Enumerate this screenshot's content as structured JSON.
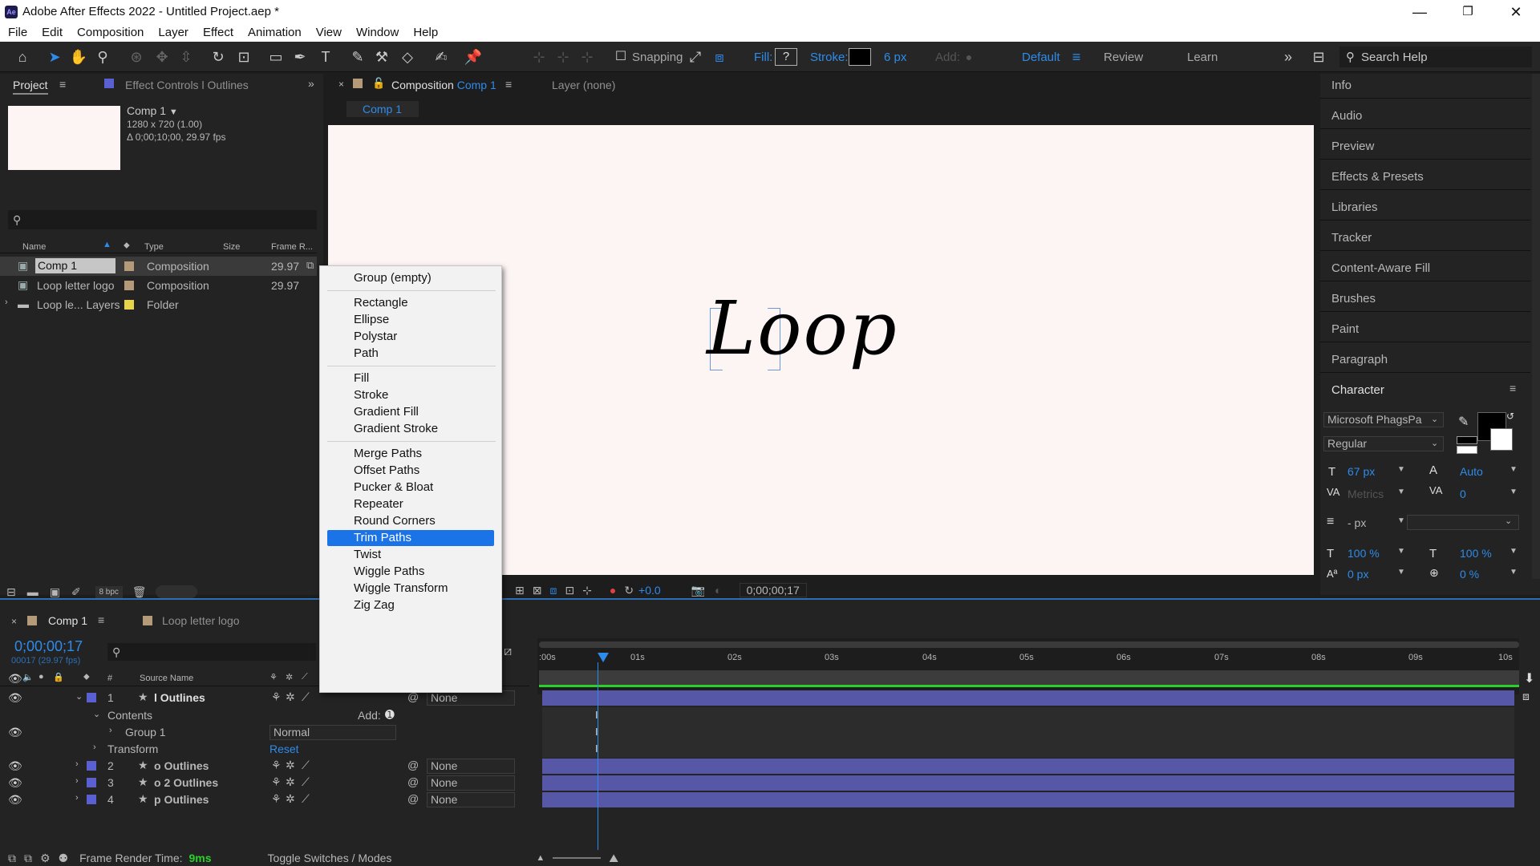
{
  "window": {
    "title": "Adobe After Effects 2022 - Untitled Project.aep *",
    "app_badge": "Ae",
    "controls": [
      "—",
      "❐",
      "✕"
    ]
  },
  "menu": [
    "File",
    "Edit",
    "Composition",
    "Layer",
    "Effect",
    "Animation",
    "View",
    "Window",
    "Help"
  ],
  "toolbar": {
    "snapping_label": "Snapping",
    "fill_label": "Fill:",
    "fill_value": "?",
    "stroke_label": "Stroke:",
    "stroke_width": "6 px",
    "add_label": "Add:",
    "workspaces": [
      "Default",
      "Review",
      "Learn"
    ],
    "active_workspace": "Default",
    "search_placeholder": "Search Help"
  },
  "project_panel": {
    "tab_project": "Project",
    "tab_effect_controls": "Effect Controls l Outlines",
    "comp_name": "Comp 1",
    "comp_res": "1280 x 720 (1.00)",
    "comp_duration": "Δ 0;00;10;00, 29.97 fps",
    "columns": {
      "name": "Name",
      "type": "Type",
      "size": "Size",
      "frame_rate": "Frame R..."
    },
    "items": [
      {
        "name": "Comp 1",
        "type": "Composition",
        "frame_rate": "29.97",
        "label_color": "#b59a7a"
      },
      {
        "name": "Loop letter logo",
        "type": "Composition",
        "frame_rate": "29.97",
        "label_color": "#b59a7a"
      },
      {
        "name": "Loop le... Layers",
        "type": "Folder",
        "frame_rate": "",
        "label_color": "#e8d44a"
      }
    ],
    "bpc": "8 bpc"
  },
  "composition": {
    "tab_label": "Composition",
    "tab_comp": "Comp 1",
    "layer_tab": "Layer  (none)",
    "breadcrumb": "Comp 1",
    "canvas_text": "Loop",
    "canvas_bg": "#fdf4f4",
    "exposure": "+0.0",
    "timecode": "0;00;00;17"
  },
  "context_menu": {
    "groups": [
      [
        "Group (empty)"
      ],
      [
        "Rectangle",
        "Ellipse",
        "Polystar",
        "Path"
      ],
      [
        "Fill",
        "Stroke",
        "Gradient Fill",
        "Gradient Stroke"
      ],
      [
        "Merge Paths",
        "Offset Paths",
        "Pucker & Bloat",
        "Repeater",
        "Round Corners",
        "Trim Paths",
        "Twist",
        "Wiggle Paths",
        "Wiggle Transform",
        "Zig Zag"
      ]
    ],
    "highlighted": "Trim Paths"
  },
  "right_panel": {
    "items": [
      "Info",
      "Audio",
      "Preview",
      "Effects & Presets",
      "Libraries",
      "Tracker",
      "Content-Aware Fill",
      "Brushes",
      "Paint",
      "Paragraph",
      "Character"
    ],
    "character": {
      "font": "Microsoft PhagsPa",
      "style": "Regular",
      "size": "67 px",
      "leading": "Auto",
      "kerning": "Metrics",
      "tracking": "0",
      "stroke_width": "- px",
      "vscale": "100 %",
      "hscale": "100 %",
      "baseline": "0 px",
      "tsume": "0 %"
    }
  },
  "timeline": {
    "tab_comp": "Comp 1",
    "tab_other": "Loop letter logo",
    "timecode": "0;00;00;17",
    "frame_info": "00017 (29.97 fps)",
    "col_source": "Source Name",
    "col_num": "#",
    "ruler": [
      ":00s",
      "01s",
      "02s",
      "03s",
      "04s",
      "05s",
      "06s",
      "07s",
      "08s",
      "09s",
      "10s"
    ],
    "layers": [
      {
        "num": "1",
        "name": "l Outlines",
        "parent": "None",
        "expanded": true
      },
      {
        "num": "2",
        "name": "o Outlines",
        "parent": "None"
      },
      {
        "num": "3",
        "name": "o 2 Outlines",
        "parent": "None"
      },
      {
        "num": "4",
        "name": "p Outlines",
        "parent": "None"
      }
    ],
    "contents_label": "Contents",
    "add_label": "Add:",
    "group_label": "Group 1",
    "blend_mode": "Normal",
    "transform_label": "Transform",
    "reset_label": "Reset",
    "render_time_label": "Frame Render Time:",
    "render_time_value": "9ms",
    "toggle_label": "Toggle Switches / Modes",
    "layer_color": "#5a5fd1"
  }
}
